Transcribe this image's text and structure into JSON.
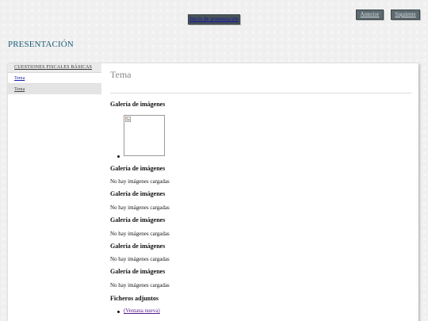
{
  "nav": {
    "start_label": "Inicio de presentación",
    "prev_label": "Anterior",
    "next_label": "Siguiente"
  },
  "page": {
    "title": "PRESENTACIÓN"
  },
  "sidebar": {
    "header": "CUESTIONES FISCALES BÁSICAS",
    "items": [
      {
        "label": "Tema"
      },
      {
        "label": "Tema"
      }
    ]
  },
  "content": {
    "title": "Tema",
    "sections": [
      {
        "heading": "Galería de imágenes"
      },
      {
        "heading": "Galería de imágenes",
        "text": "No hay imágenes cargadas"
      },
      {
        "heading": "Galería de imágenes",
        "text": "No hay imágenes cargadas"
      },
      {
        "heading": "Galería de imágenes",
        "text": "No hay imágenes cargadas"
      },
      {
        "heading": "Galería de imágenes",
        "text": "No hay imágenes cargadas"
      },
      {
        "heading": "Galería de imágenes",
        "text": "No hay imágenes cargadas"
      }
    ],
    "attachments": {
      "heading": "Ficheros adjuntos",
      "link_label": "(Ventana nueva)"
    }
  },
  "colors": {
    "title_blue": "#1d5f7c",
    "button_gray": "#5e6b70",
    "link_blue": "#2222aa",
    "visited_purple": "#551a8b"
  },
  "icons": {
    "broken_image": "broken-image-icon"
  }
}
